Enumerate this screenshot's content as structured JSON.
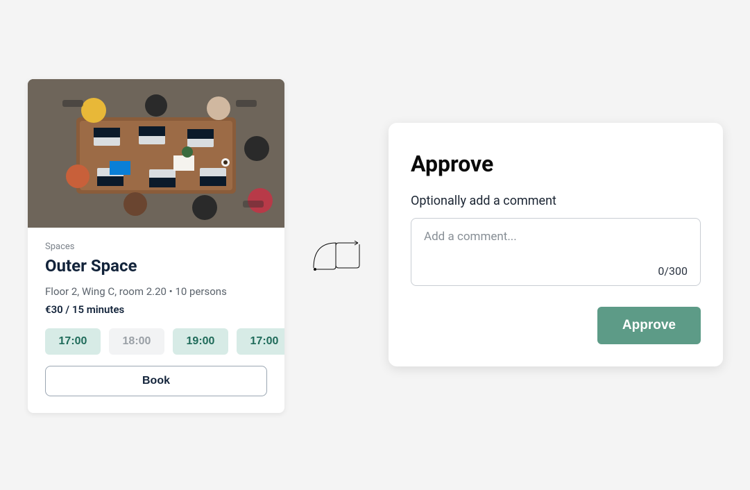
{
  "space_card": {
    "category": "Spaces",
    "title": "Outer Space",
    "meta": "Floor 2, Wing C, room 2.20 • 10 persons",
    "price": "€30 / 15 minutes",
    "time_slots": [
      {
        "label": "17:00",
        "available": true
      },
      {
        "label": "18:00",
        "available": false
      },
      {
        "label": "19:00",
        "available": true
      },
      {
        "label": "17:00",
        "available": true
      }
    ],
    "book_label": "Book"
  },
  "approve_card": {
    "title": "Approve",
    "comment_label": "Optionally add a comment",
    "comment_placeholder": "Add a comment...",
    "char_counter": "0/300",
    "approve_label": "Approve"
  }
}
